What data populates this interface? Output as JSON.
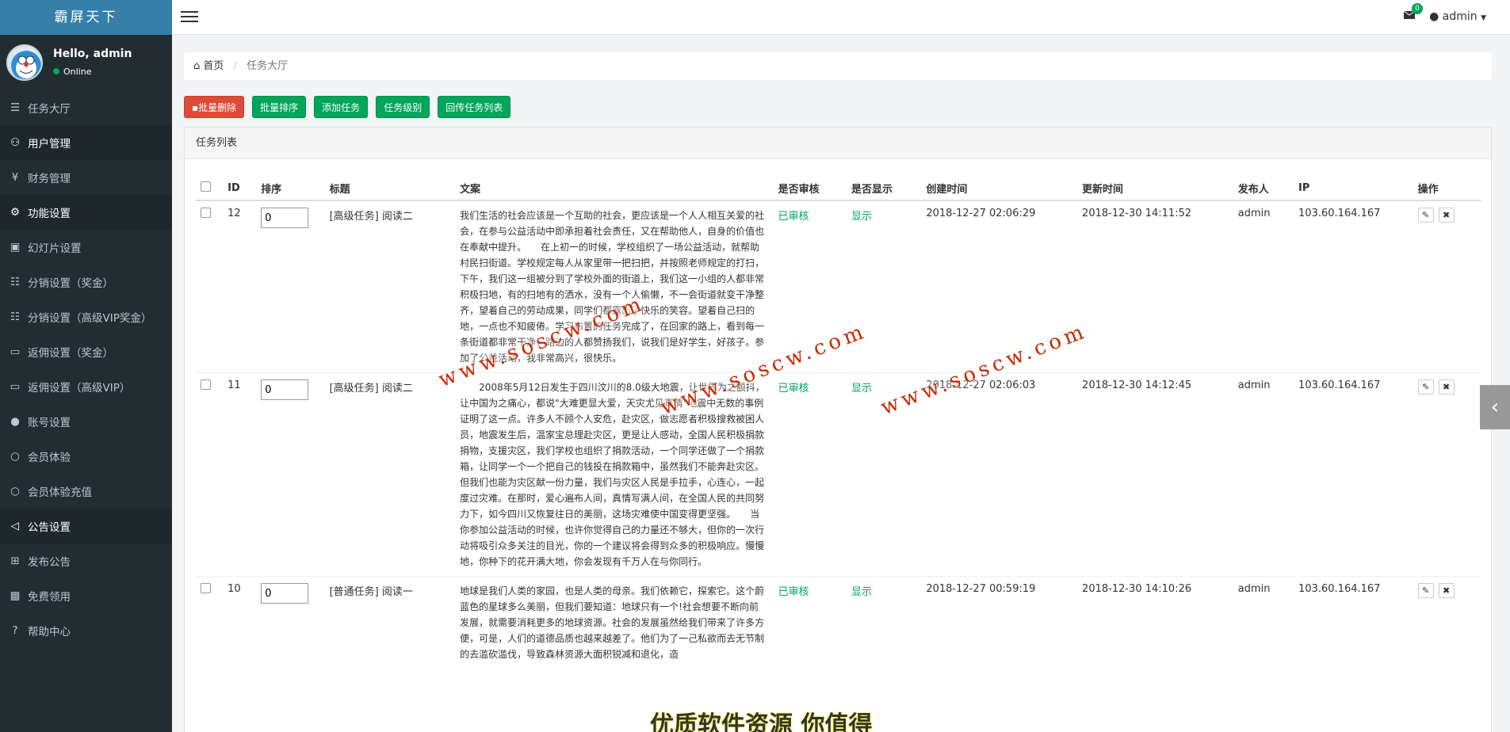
{
  "sidebar": {
    "brand": "霸屏天下",
    "greeting": "Hello, admin",
    "status": "Online",
    "menu": [
      {
        "label": "任务大厅",
        "icon": "list-icon"
      },
      {
        "label": "用户管理",
        "icon": "users-icon"
      },
      {
        "label": "财务管理",
        "icon": "yen-icon"
      },
      {
        "label": "功能设置",
        "icon": "gears-icon"
      },
      {
        "label": "幻灯片设置",
        "icon": "film-icon"
      },
      {
        "label": "分销设置（奖金）",
        "icon": "sitemap-icon"
      },
      {
        "label": "分销设置（高级VIP奖金）",
        "icon": "sitemap-icon"
      },
      {
        "label": "返佣设置（奖金）",
        "icon": "credit-card-icon"
      },
      {
        "label": "返佣设置（高级VIP）",
        "icon": "credit-card-icon"
      },
      {
        "label": "账号设置",
        "icon": "user-icon"
      },
      {
        "label": "会员体验",
        "icon": "circle-icon"
      },
      {
        "label": "会员体验充值",
        "icon": "circle-icon"
      },
      {
        "label": "公告设置",
        "icon": "bullhorn-icon"
      },
      {
        "label": "发布公告",
        "icon": "plus-square-icon"
      },
      {
        "label": "免费领用",
        "icon": "gift-icon"
      },
      {
        "label": "帮助中心",
        "icon": "question-circle-icon"
      }
    ]
  },
  "topbar": {
    "mail_count": "0",
    "user": "admin"
  },
  "breadcrumb": {
    "home": "首页",
    "current": "任务大厅"
  },
  "actions": {
    "batch_delete": "批量删除",
    "batch_sort": "批量排序",
    "add_task": "添加任务",
    "task_level": "任务级别",
    "return_list": "回传任务列表"
  },
  "panel_title": "任务列表",
  "table": {
    "headers": [
      "ID",
      "排序",
      "标题",
      "文案",
      "是否审核",
      "是否显示",
      "创建时间",
      "更新时间",
      "发布人",
      "IP",
      "操作"
    ],
    "rows": [
      {
        "id": "12",
        "sort": "0",
        "title": "[高级任务] 阅读二",
        "text": "我们生活的社会应该是一个互助的社会，更应该是一个人人相互关爱的社会，在参与公益活动中即承担着社会责任，又在帮助他人，自身的价值也在奉献中提升。　　在上初一的时候，学校组织了一场公益活动，就帮助村民扫街道。学校规定每人从家里带一把扫把，并按照老师规定的打扫，下午，我们这一组被分到了学校外面的街道上，我们这一小组的人都非常积极扫地，有的扫地有的洒水，没有一个人偷懒，不一会街道就变干净整齐，望着自己的劳动成果，同学们都露出了快乐的笑容。望着自己扫的地，一点也不知疲倦。学习布置的任务完成了，在回家的路上，看到每一条街道都非常干净，路边的人都赞扬我们，说我们是好学生，好孩子。参加了公益活动，我非常高兴，很快乐。",
        "audit": "已审核",
        "show": "显示",
        "created": "2018-12-27 02:06:29",
        "updated": "2018-12-30 14:11:52",
        "publisher": "admin",
        "ip": "103.60.164.167"
      },
      {
        "id": "11",
        "sort": "0",
        "title": "[高级任务] 阅读二",
        "text": "　　2008年5月12日发生于四川汶川的8.0级大地震，让世界为之颤抖，让中国为之痛心，都说\"大难更显大爱，天灾尤见真情\"地震中无数的事例证明了这一点。许多人不顾个人安危，赴灾区，做志愿者积极搜救被困人员，地震发生后，温家宝总理赴灾区，更是让人感动，全国人民积极捐款捐物，支援灾区，我们学校也组织了捐款活动，一个同学还做了一个捐款箱，让同学一个一个把自己的钱投在捐款箱中，虽然我们不能奔赴灾区。但我们也能为灾区献一份力量，我们与灾区人民是手拉手，心连心，一起度过灾难。在那时，爱心遍布人间，真情写满人间，在全国人民的共同努力下，如今四川又恢复往日的美丽，这场灾难使中国变得更坚强。　　当你参加公益活动的时候，也许你觉得自己的力量还不够大，但你的一次行动将吸引众多关注的目光，你的一个建议将会得到众多的积极响应。慢慢地，你种下的花开满大地，你会发现有千万人在与你同行。",
        "audit": "已审核",
        "show": "显示",
        "created": "2018-12-27 02:06:03",
        "updated": "2018-12-30 14:12:45",
        "publisher": "admin",
        "ip": "103.60.164.167"
      },
      {
        "id": "10",
        "sort": "0",
        "title": "[普通任务] 阅读一",
        "text": "地球是我们人类的家园，也是人类的母亲。我们依赖它，探索它。这个蔚蓝色的星球多么美丽，但我们要知道：地球只有一个!社会想要不断向前发展，就需要消耗更多的地球资源。社会的发展虽然给我们带来了许多方便，可是，人们的道德品质也越来越差了。他们为了一己私欲而去无节制的去滥砍滥伐，导致森林资源大面积锐减和退化，造",
        "audit": "已审核",
        "show": "显示",
        "created": "2018-12-27 00:59:19",
        "updated": "2018-12-30 14:10:26",
        "publisher": "admin",
        "ip": "103.60.164.167"
      }
    ]
  },
  "watermark": "www.soscw.com",
  "watermark2": "优质软件资源 你值得"
}
